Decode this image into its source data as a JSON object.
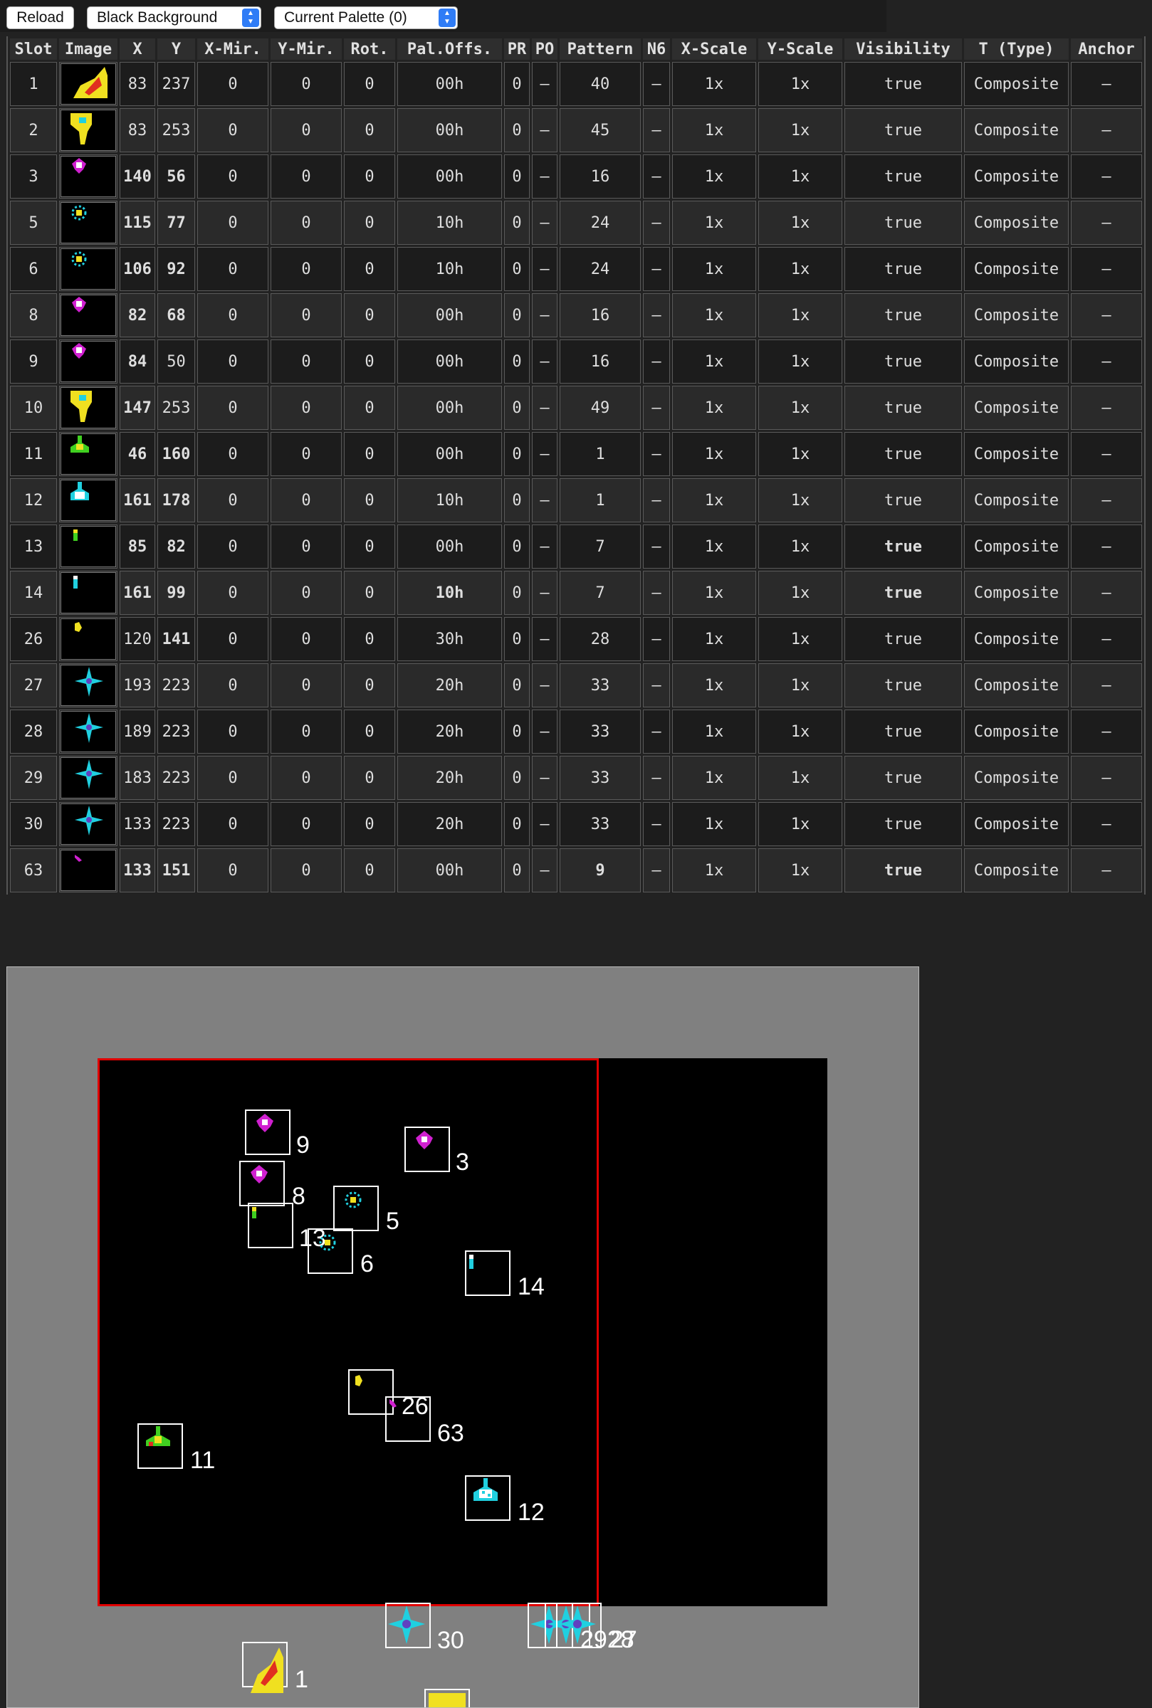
{
  "toolbar": {
    "reload_label": "Reload",
    "background_select": "Black Background",
    "palette_select": "Current Palette (0)"
  },
  "table": {
    "headers": [
      "Slot",
      "Image",
      "X",
      "Y",
      "X-Mir.",
      "Y-Mir.",
      "Rot.",
      "Pal.Offs.",
      "PR",
      "PO",
      "Pattern",
      "N6",
      "X-Scale",
      "Y-Scale",
      "Visibility",
      "T (Type)",
      "Anchor"
    ],
    "rows": [
      {
        "slot": "1",
        "image": "flame-sprite",
        "x": "83",
        "y": "237",
        "xmir": "0",
        "ymir": "0",
        "rot": "0",
        "pal": "00h",
        "pr": "0",
        "po": "–",
        "pattern": "40",
        "n6": "–",
        "xscale": "1x",
        "yscale": "1x",
        "vis": "true",
        "type": "Composite",
        "anchor": "–"
      },
      {
        "slot": "2",
        "image": "yellow-blob-sprite",
        "x": "83",
        "y": "253",
        "xmir": "0",
        "ymir": "0",
        "rot": "0",
        "pal": "00h",
        "pr": "0",
        "po": "–",
        "pattern": "45",
        "n6": "–",
        "xscale": "1x",
        "yscale": "1x",
        "vis": "true",
        "type": "Composite",
        "anchor": "–"
      },
      {
        "slot": "3",
        "image": "magenta-ship-sprite",
        "x": "140",
        "y": "56",
        "xmir": "0",
        "ymir": "0",
        "rot": "0",
        "pal": "00h",
        "pr": "0",
        "po": "–",
        "pattern": "16",
        "n6": "–",
        "xscale": "1x",
        "yscale": "1x",
        "vis": "true",
        "type": "Composite",
        "anchor": "–"
      },
      {
        "slot": "5",
        "image": "cyan-ship-sprite",
        "x": "115",
        "y": "77",
        "xmir": "0",
        "ymir": "0",
        "rot": "0",
        "pal": "10h",
        "pr": "0",
        "po": "–",
        "pattern": "24",
        "n6": "–",
        "xscale": "1x",
        "yscale": "1x",
        "vis": "true",
        "type": "Composite",
        "anchor": "–"
      },
      {
        "slot": "6",
        "image": "cyan-ship-sprite",
        "x": "106",
        "y": "92",
        "xmir": "0",
        "ymir": "0",
        "rot": "0",
        "pal": "10h",
        "pr": "0",
        "po": "–",
        "pattern": "24",
        "n6": "–",
        "xscale": "1x",
        "yscale": "1x",
        "vis": "true",
        "type": "Composite",
        "anchor": "–"
      },
      {
        "slot": "8",
        "image": "magenta-ship-sprite",
        "x": "82",
        "y": "68",
        "xmir": "0",
        "ymir": "0",
        "rot": "0",
        "pal": "00h",
        "pr": "0",
        "po": "–",
        "pattern": "16",
        "n6": "–",
        "xscale": "1x",
        "yscale": "1x",
        "vis": "true",
        "type": "Composite",
        "anchor": "–"
      },
      {
        "slot": "9",
        "image": "magenta-ship-sprite",
        "x": "84",
        "y": "50",
        "xmir": "0",
        "ymir": "0",
        "rot": "0",
        "pal": "00h",
        "pr": "0",
        "po": "–",
        "pattern": "16",
        "n6": "–",
        "xscale": "1x",
        "yscale": "1x",
        "vis": "true",
        "type": "Composite",
        "anchor": "–"
      },
      {
        "slot": "10",
        "image": "yellow-blob-sprite",
        "x": "147",
        "y": "253",
        "xmir": "0",
        "ymir": "0",
        "rot": "0",
        "pal": "00h",
        "pr": "0",
        "po": "–",
        "pattern": "49",
        "n6": "–",
        "xscale": "1x",
        "yscale": "1x",
        "vis": "true",
        "type": "Composite",
        "anchor": "–"
      },
      {
        "slot": "11",
        "image": "green-fighter-sprite",
        "x": "46",
        "y": "160",
        "xmir": "0",
        "ymir": "0",
        "rot": "0",
        "pal": "00h",
        "pr": "0",
        "po": "–",
        "pattern": "1",
        "n6": "–",
        "xscale": "1x",
        "yscale": "1x",
        "vis": "true",
        "type": "Composite",
        "anchor": "–"
      },
      {
        "slot": "12",
        "image": "cyan-fighter-sprite",
        "x": "161",
        "y": "178",
        "xmir": "0",
        "ymir": "0",
        "rot": "0",
        "pal": "10h",
        "pr": "0",
        "po": "–",
        "pattern": "1",
        "n6": "–",
        "xscale": "1x",
        "yscale": "1x",
        "vis": "true",
        "type": "Composite",
        "anchor": "–"
      },
      {
        "slot": "13",
        "image": "green-bullet-sprite",
        "x": "85",
        "y": "82",
        "xmir": "0",
        "ymir": "0",
        "rot": "0",
        "pal": "00h",
        "pr": "0",
        "po": "–",
        "pattern": "7",
        "n6": "–",
        "xscale": "1x",
        "yscale": "1x",
        "vis": "true",
        "type": "Composite",
        "anchor": "–"
      },
      {
        "slot": "14",
        "image": "cyan-bullet-sprite",
        "x": "161",
        "y": "99",
        "xmir": "0",
        "ymir": "0",
        "rot": "0",
        "pal": "10h",
        "pr": "0",
        "po": "–",
        "pattern": "7",
        "n6": "–",
        "xscale": "1x",
        "yscale": "1x",
        "vis": "true",
        "type": "Composite",
        "anchor": "–"
      },
      {
        "slot": "26",
        "image": "yellow-small-sprite",
        "x": "120",
        "y": "141",
        "xmir": "0",
        "ymir": "0",
        "rot": "0",
        "pal": "30h",
        "pr": "0",
        "po": "–",
        "pattern": "28",
        "n6": "–",
        "xscale": "1x",
        "yscale": "1x",
        "vis": "true",
        "type": "Composite",
        "anchor": "–"
      },
      {
        "slot": "27",
        "image": "cyan-star-sprite",
        "x": "193",
        "y": "223",
        "xmir": "0",
        "ymir": "0",
        "rot": "0",
        "pal": "20h",
        "pr": "0",
        "po": "–",
        "pattern": "33",
        "n6": "–",
        "xscale": "1x",
        "yscale": "1x",
        "vis": "true",
        "type": "Composite",
        "anchor": "–"
      },
      {
        "slot": "28",
        "image": "cyan-star-sprite",
        "x": "189",
        "y": "223",
        "xmir": "0",
        "ymir": "0",
        "rot": "0",
        "pal": "20h",
        "pr": "0",
        "po": "–",
        "pattern": "33",
        "n6": "–",
        "xscale": "1x",
        "yscale": "1x",
        "vis": "true",
        "type": "Composite",
        "anchor": "–"
      },
      {
        "slot": "29",
        "image": "cyan-star-sprite",
        "x": "183",
        "y": "223",
        "xmir": "0",
        "ymir": "0",
        "rot": "0",
        "pal": "20h",
        "pr": "0",
        "po": "–",
        "pattern": "33",
        "n6": "–",
        "xscale": "1x",
        "yscale": "1x",
        "vis": "true",
        "type": "Composite",
        "anchor": "–"
      },
      {
        "slot": "30",
        "image": "cyan-star-sprite",
        "x": "133",
        "y": "223",
        "xmir": "0",
        "ymir": "0",
        "rot": "0",
        "pal": "20h",
        "pr": "0",
        "po": "–",
        "pattern": "33",
        "n6": "–",
        "xscale": "1x",
        "yscale": "1x",
        "vis": "true",
        "type": "Composite",
        "anchor": "–"
      },
      {
        "slot": "63",
        "image": "magenta-dot-sprite",
        "x": "133",
        "y": "151",
        "xmir": "0",
        "ymir": "0",
        "rot": "0",
        "pal": "00h",
        "pr": "0",
        "po": "–",
        "pattern": "9",
        "n6": "–",
        "xscale": "1x",
        "yscale": "1x",
        "vis": "true",
        "type": "Composite",
        "anchor": "–"
      }
    ]
  },
  "preview": {
    "labels": {
      "s9": "9",
      "s3": "3",
      "s8": "8",
      "s5": "5",
      "s13": "13",
      "s6": "6",
      "s14": "14",
      "s26": "26",
      "s63": "63",
      "s11": "11",
      "s12": "12",
      "s30": "30",
      "s2928": "2928",
      "s27": "27",
      "s1": "1"
    }
  },
  "colors": {
    "page_bg": "#222222",
    "preview_bg": "#808080",
    "visible_border": "#e00000",
    "sprite_box": "#ffffff",
    "magenta": "#d020d0",
    "cyan": "#20d0e0",
    "yellow": "#f0e020",
    "green": "#40d020",
    "red": "#e03020"
  }
}
